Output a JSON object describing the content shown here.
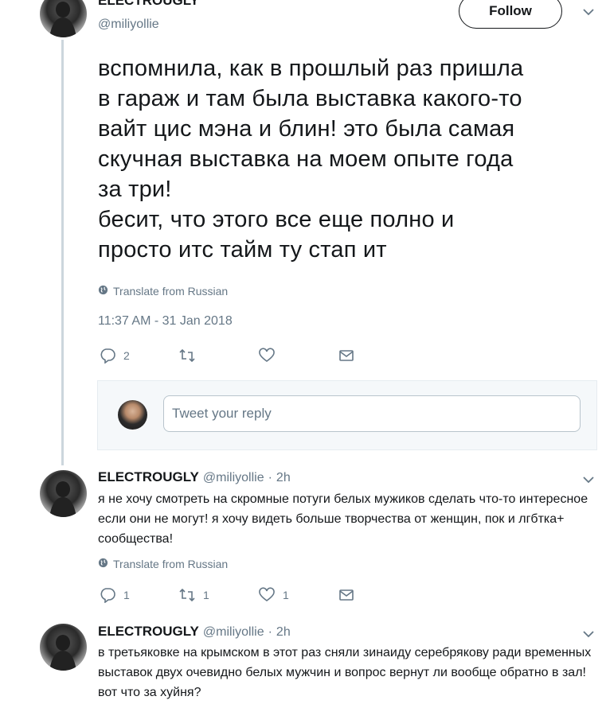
{
  "main_tweet": {
    "display_name": "ELECTROUGLY",
    "handle": "@miliyollie",
    "follow_label": "Follow",
    "text": "вспомнила, как в прошлый раз пришла\nв гараж и там была выставка какого-то\nвайт цис мэна и блин! это была самая\nскучная выставка на моем опыте года\nза три!\nбесит, что этого все еще полно и\nпросто итс тайм ту стап ит",
    "translate_label": "Translate from Russian",
    "timestamp": "11:37 AM - 31 Jan 2018",
    "reply_count": "2",
    "retweet_count": "",
    "like_count": ""
  },
  "reply_composer": {
    "placeholder": "Tweet your reply"
  },
  "replies": [
    {
      "display_name": "ELECTROUGLY",
      "handle": "@miliyollie",
      "separator": "·",
      "time": "2h",
      "text": "я не хочу смотреть на скромные потуги белых мужиков сделать что-то интересное если они не могут! я хочу видеть больше творчества от женщин, пок и лгбтка+ сообщества!",
      "translate_label": "Translate from Russian",
      "reply_count": "1",
      "retweet_count": "1",
      "like_count": "1"
    },
    {
      "display_name": "ELECTROUGLY",
      "handle": "@miliyollie",
      "separator": "·",
      "time": "2h",
      "text": "в третьяковке на крымском в этот раз сняли зинаиду серебрякову ради временных выставок двух очевидно белых мужчин и вопрос вернут ли вообще обратно в зал! вот что за хуйня?"
    }
  ],
  "icons": {
    "reply": "reply-icon",
    "retweet": "retweet-icon",
    "like": "heart-icon",
    "dm": "envelope-icon",
    "globe": "globe-icon",
    "caret": "chevron-down-icon"
  },
  "colors": {
    "text": "#14171a",
    "secondary": "#657786",
    "thread_line": "#ccd6dd",
    "composer_bg": "#f5f8fa"
  }
}
